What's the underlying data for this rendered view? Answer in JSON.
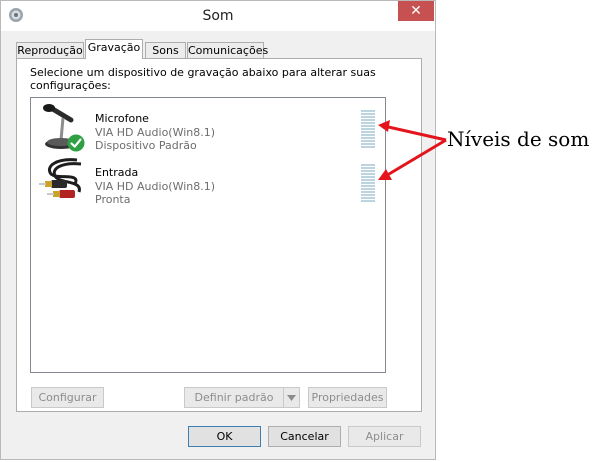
{
  "window": {
    "title": "Som",
    "close_glyph": "✕"
  },
  "tabs": [
    {
      "label": "Reprodução"
    },
    {
      "label": "Gravação",
      "active": true
    },
    {
      "label": "Sons"
    },
    {
      "label": "Comunicações"
    }
  ],
  "instruction": "Selecione um dispositivo de gravação abaixo para alterar suas configurações:",
  "devices": [
    {
      "name": "Microfone",
      "driver": "VIA HD Audio(Win8.1)",
      "status": "Dispositivo Padrão",
      "icon": "microphone-icon",
      "default_badge": "check-icon"
    },
    {
      "name": "Entrada",
      "driver": "VIA HD Audio(Win8.1)",
      "status": "Pronta",
      "icon": "rca-cable-icon"
    }
  ],
  "panel_buttons": {
    "configure": "Configurar",
    "set_default": "Definir padrão",
    "properties": "Propriedades"
  },
  "dialog_buttons": {
    "ok": "OK",
    "cancel": "Cancelar",
    "apply": "Aplicar"
  },
  "annotation": {
    "text": "Níveis de som",
    "arrow_color": "#e3141b"
  },
  "colors": {
    "close": "#c75050",
    "meter": "#bcd3e0",
    "check": "#2ea043"
  }
}
